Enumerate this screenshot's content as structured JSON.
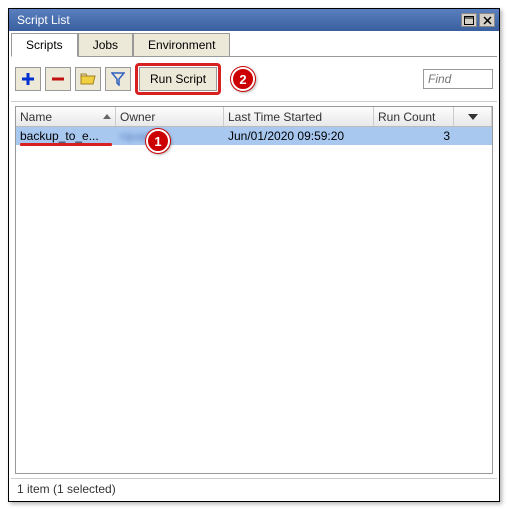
{
  "window": {
    "title": "Script List"
  },
  "tabs": [
    {
      "label": "Scripts",
      "active": true
    },
    {
      "label": "Jobs",
      "active": false
    },
    {
      "label": "Environment",
      "active": false
    }
  ],
  "toolbar": {
    "run_label": "Run Script",
    "find_placeholder": "Find"
  },
  "columns": {
    "name": "Name",
    "owner": "Owner",
    "last_time": "Last Time Started",
    "run_count": "Run Count"
  },
  "rows": [
    {
      "name": "backup_to_e...",
      "owner": "rquade",
      "last_time": "Jun/01/2020 09:59:20",
      "run_count": "3",
      "selected": true
    }
  ],
  "callouts": {
    "one": "1",
    "two": "2"
  },
  "status": "1 item (1 selected)"
}
